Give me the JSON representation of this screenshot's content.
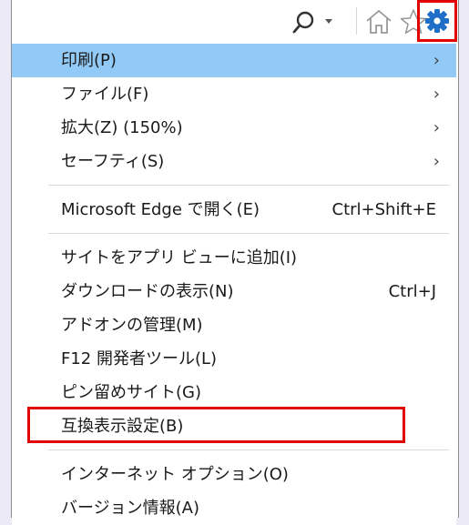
{
  "toolbar": {
    "search_icon": "search-icon",
    "dropdown_icon": "chevron-down-icon",
    "home_icon": "home-icon",
    "favorites_icon": "star-icon",
    "tools_icon": "gear-icon",
    "accent_color": "#1e6fc8",
    "highlight_color": "#e00000"
  },
  "menu": {
    "items": [
      {
        "label": "印刷(P)",
        "submenu": true,
        "arrow": "›"
      },
      {
        "label": "ファイル(F)",
        "submenu": true,
        "arrow": "›"
      },
      {
        "label": "拡大(Z) (150%)",
        "submenu": true,
        "arrow": "›"
      },
      {
        "label": "セーフティ(S)",
        "submenu": true,
        "arrow": "›"
      },
      {
        "label": "Microsoft Edge で開く(E)",
        "shortcut": "Ctrl+Shift+E"
      },
      {
        "label": "サイトをアプリ ビューに追加(I)"
      },
      {
        "label": "ダウンロードの表示(N)",
        "shortcut": "Ctrl+J"
      },
      {
        "label": "アドオンの管理(M)"
      },
      {
        "label": "F12 開発者ツール(L)"
      },
      {
        "label": "ピン留めサイト(G)"
      },
      {
        "label": "互換表示設定(B)"
      },
      {
        "label": "インターネット オプション(O)"
      },
      {
        "label": "バージョン情報(A)"
      }
    ],
    "highlight_bg": "#91c9f7"
  }
}
